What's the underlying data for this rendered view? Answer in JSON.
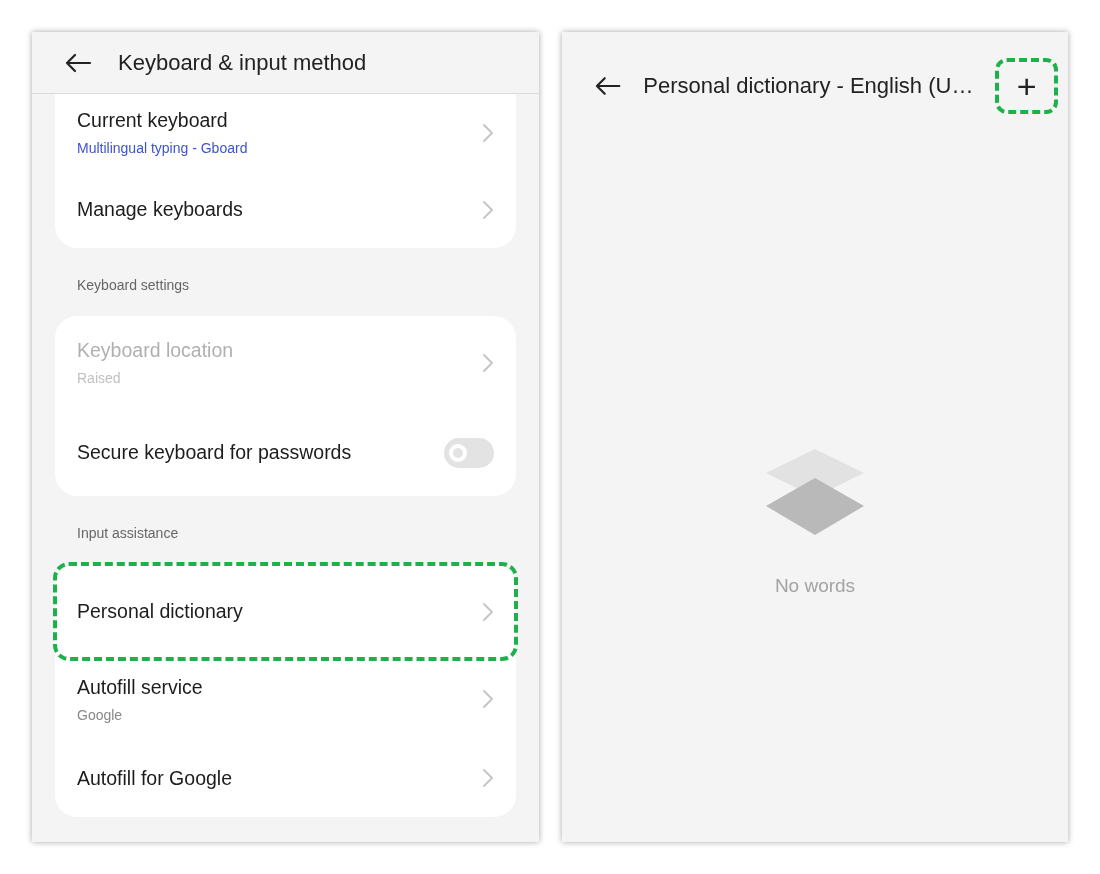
{
  "settings_screen": {
    "title": "Keyboard & input method",
    "groups": [
      {
        "items": [
          {
            "kind": "link",
            "title": "Current keyboard",
            "subtitle": "Multilingual typing - Gboard",
            "subtitle_accent": true,
            "disabled": false,
            "highlighted": false
          },
          {
            "kind": "link",
            "title": "Manage keyboards",
            "disabled": false,
            "highlighted": false
          }
        ]
      },
      {
        "label": "Keyboard settings",
        "items": [
          {
            "kind": "link",
            "title": "Keyboard location",
            "subtitle": "Raised",
            "disabled": true,
            "highlighted": false
          },
          {
            "kind": "toggle",
            "title": "Secure keyboard for passwords",
            "on": false,
            "disabled": false,
            "highlighted": false
          }
        ]
      },
      {
        "label": "Input assistance",
        "items": [
          {
            "kind": "link",
            "title": "Personal dictionary",
            "disabled": false,
            "highlighted": true
          },
          {
            "kind": "link",
            "title": "Autofill service",
            "subtitle": "Google",
            "subtitle_accent": false,
            "disabled": false,
            "highlighted": false
          },
          {
            "kind": "link",
            "title": "Autofill for Google",
            "disabled": false,
            "highlighted": false
          }
        ]
      }
    ]
  },
  "dictionary_screen": {
    "title": "Personal dictionary - English (U…",
    "add_button": {
      "label": "+",
      "highlighted": true
    },
    "empty_text": "No words"
  }
}
